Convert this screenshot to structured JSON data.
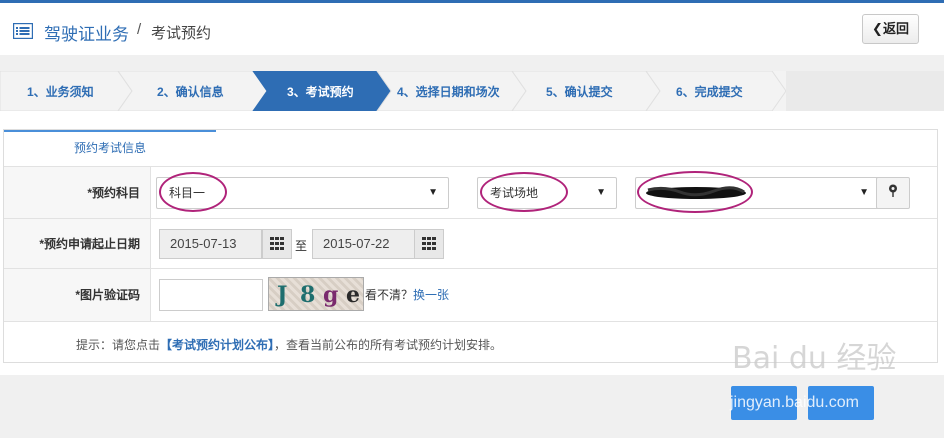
{
  "header": {
    "title": "驾驶证业务",
    "separator": "/",
    "subtitle": "考试预约",
    "back_label": "返回"
  },
  "steps": [
    {
      "label": "1、业务须知",
      "active": false
    },
    {
      "label": "2、确认信息",
      "active": false
    },
    {
      "label": "3、考试预约",
      "active": true
    },
    {
      "label": "4、选择日期和场次",
      "active": false
    },
    {
      "label": "5、确认提交",
      "active": false
    },
    {
      "label": "6、完成提交",
      "active": false
    }
  ],
  "form": {
    "tab_label": "预约考试信息",
    "subject": {
      "label": "*预约科目",
      "value": "科目一"
    },
    "venue_type": {
      "value": "考试场地"
    },
    "venue": {
      "value": ""
    },
    "date_range": {
      "label": "*预约申请起止日期",
      "start": "2015-07-13",
      "separator": "至",
      "end": "2015-07-22"
    },
    "captcha": {
      "label": "*图片验证码",
      "input_value": "",
      "image_text": [
        "J",
        "8",
        "g",
        "e"
      ],
      "help_text": "看不清？",
      "refresh_link": "换一张"
    },
    "hint": {
      "prefix": "提示：请您点击",
      "link": "【考试预约计划公布】",
      "suffix": "，查看当前公布的所有考试预约计划安排。"
    }
  },
  "footer": {
    "btn1_label": "",
    "btn2_label": ""
  },
  "watermark": {
    "brand": "Bai du 经验",
    "url": "jingyan.baidu.com"
  },
  "colors": {
    "accent": "#2e6db4",
    "active_step": "#2e6db4",
    "highlight_ellipse": "#b0237a",
    "button": "#3a8ee6"
  }
}
